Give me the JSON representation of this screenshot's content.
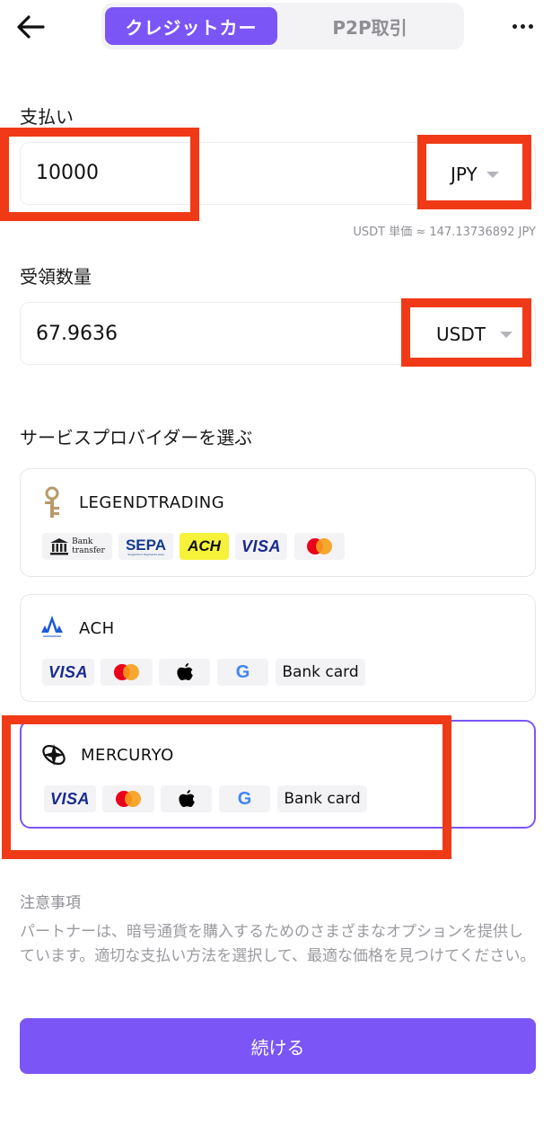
{
  "header": {
    "tabs": [
      {
        "label": "クレジットカー"
      },
      {
        "label": "P2P取引"
      }
    ]
  },
  "payment": {
    "label": "支払い",
    "amount": "10000",
    "currency": "JPY"
  },
  "rate_text": "USDT 単価 ≈ 147.13736892 JPY",
  "receive": {
    "label": "受領数量",
    "amount": "67.9636",
    "currency": "USDT"
  },
  "providers_title": "サービスプロバイダーを選ぶ",
  "providers": [
    {
      "name": "LEGENDTRADING",
      "methods": [
        {
          "label": "Bank transfer",
          "line1": "Bank",
          "line2": "transfer"
        },
        {
          "label": "SEPA",
          "sub": "Single Euro Payments Area"
        },
        {
          "label": "ACH"
        },
        {
          "label": "VISA"
        },
        {
          "label": "mastercard-icon"
        }
      ]
    },
    {
      "name": "ACH",
      "methods": [
        {
          "label": "VISA"
        },
        {
          "label": "mastercard-icon"
        },
        {
          "label": "apple-pay-icon"
        },
        {
          "label": "G"
        },
        {
          "label": "Bank card"
        }
      ]
    },
    {
      "name": "MERCURYO",
      "selected": true,
      "methods": [
        {
          "label": "VISA"
        },
        {
          "label": "mastercard-icon"
        },
        {
          "label": "apple-pay-icon"
        },
        {
          "label": "G"
        },
        {
          "label": "Bank card"
        }
      ]
    }
  ],
  "notes": {
    "title": "注意事項",
    "body": "パートナーは、暗号通貨を購入するためのさまざまなオプションを提供しています。適切な支払い方法を選択して、最適な価格を見つけてください。"
  },
  "continue_label": "続ける",
  "colors": {
    "accent": "#7b55f5",
    "annotation_red": "#f03a17"
  }
}
